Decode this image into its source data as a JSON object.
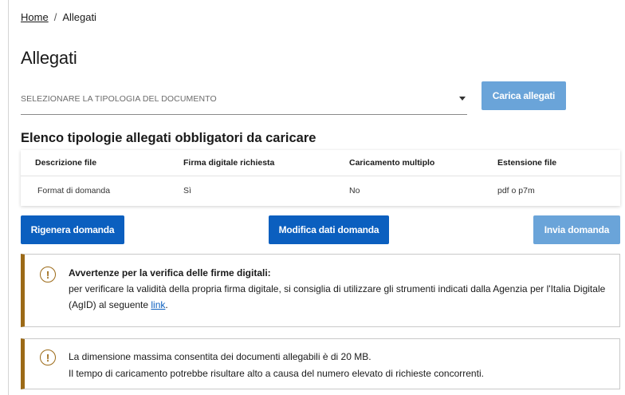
{
  "breadcrumb": {
    "home": "Home",
    "separator": "/",
    "current": "Allegati"
  },
  "page_title": "Allegati",
  "document_type_select": {
    "placeholder": "SELEZIONARE LA TIPOLOGIA DEL DOCUMENTO"
  },
  "upload_button": "Carica allegati",
  "section_title": "Elenco tipologie allegati obbligatori da caricare",
  "table": {
    "columns": [
      "Descrizione file",
      "Firma digitale richiesta",
      "Caricamento multiplo",
      "Estensione file"
    ],
    "rows": [
      [
        "Format di domanda",
        "Sì",
        "No",
        "pdf o p7m"
      ]
    ]
  },
  "actions": {
    "regenerate": "Rigenera domanda",
    "edit": "Modifica dati domanda",
    "send": "Invia domanda"
  },
  "alert_signatures": {
    "icon": "exclamation-circle-icon",
    "title": "Avvertenze per la verifica delle firme digitali:",
    "text_before_link": "per verificare la validità della propria firma digitale, si consiglia di utilizzare gli strumenti indicati dalla Agenzia per l'Italia Digitale (AgID) al seguente ",
    "link": "link",
    "text_after_link": "."
  },
  "alert_size": {
    "icon": "exclamation-circle-icon",
    "line1": "La dimensione massima consentita dei documenti allegabili è di 20 MB.",
    "line2": "Il tempo di caricamento potrebbe risultare alto a causa del numero elevato di richieste concorrenti."
  },
  "colors": {
    "primary": "#0b5fbf",
    "primary_disabled": "#6aa4d9",
    "warning_accent": "#9c6a17"
  }
}
